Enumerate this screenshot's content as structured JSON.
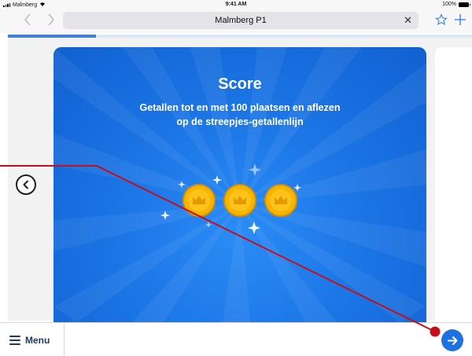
{
  "status_bar": {
    "carrier": "Malmberg",
    "time": "9:41 AM",
    "battery": "100%"
  },
  "browser": {
    "url_title": "Malmberg P1",
    "clear_symbol": "✕",
    "back_icon": "chevron-left-icon",
    "forward_icon": "chevron-right-icon",
    "bookmark_icon": "star-icon",
    "add_tab_icon": "plus-icon"
  },
  "score": {
    "title": "Score",
    "subtitle_line1": "Getallen tot en met 100 plaatsen en aflezen",
    "subtitle_line2": "op de streepjes-getallenlijn",
    "medals_earned": 3
  },
  "bottom_bar": {
    "menu_label": "Menu"
  },
  "colors": {
    "card_blue": "#1c76e6",
    "medal_gold": "#f5b400",
    "pointer_red": "#c40f1c",
    "next_button_blue": "#1c72e0"
  }
}
